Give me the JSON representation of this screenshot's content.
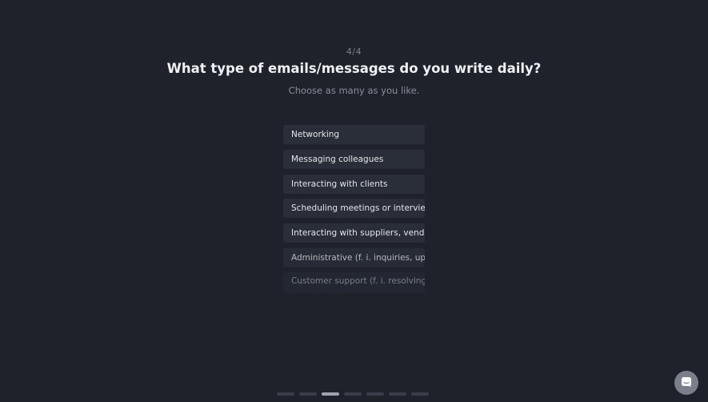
{
  "step": {
    "current": 4,
    "total": 4,
    "label": "4/4"
  },
  "question": {
    "title": "What type of emails/messages do you write daily?",
    "subtitle": "Choose as many as you like."
  },
  "options": [
    {
      "label": "Networking",
      "selected": false
    },
    {
      "label": "Messaging colleagues",
      "selected": false
    },
    {
      "label": "Interacting with clients",
      "selected": false
    },
    {
      "label": "Scheduling meetings or interviews",
      "selected": false
    },
    {
      "label": "Interacting with suppliers, vendors",
      "selected": false
    },
    {
      "label": "Administrative (f. i. inquiries, updates)",
      "selected": false
    },
    {
      "label": "Customer support (f. i. resolving",
      "selected": false
    }
  ],
  "progress": {
    "segments": 7,
    "active_index": 2
  },
  "chat_widget": {
    "icon": "chat-icon"
  },
  "colors": {
    "background": "#1f222b",
    "option_background": "#2a2e39",
    "title": "#eef0f3",
    "muted_text": "#8a8f9a",
    "progress_active": "#9ea3ad",
    "progress_inactive": "#3a3e49"
  }
}
